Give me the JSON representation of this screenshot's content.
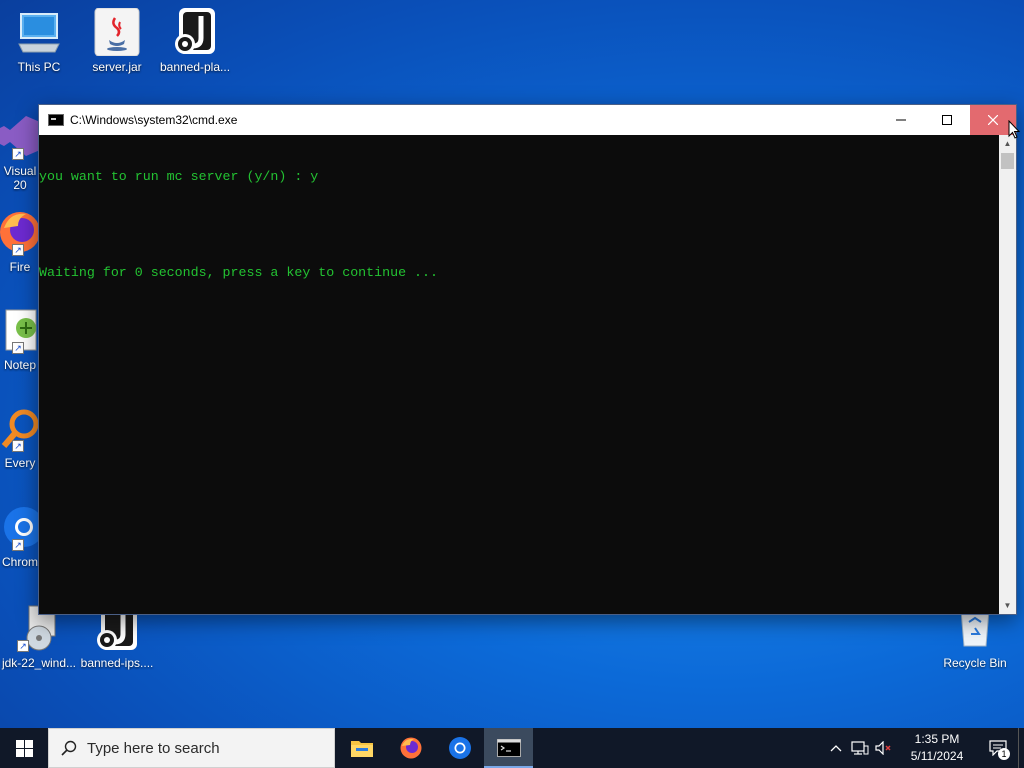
{
  "desktop": {
    "icons_top": [
      {
        "label": "This PC",
        "icon": "monitor-icon"
      },
      {
        "label": "server.jar",
        "icon": "java-icon"
      },
      {
        "label": "banned-pla...",
        "icon": "json-file-icon"
      }
    ],
    "icons_left_partial": [
      {
        "label": "Visual",
        "label2": "20",
        "icon": "visual-studio-icon"
      },
      {
        "label": "Fire",
        "icon": "firefox-icon"
      },
      {
        "label": "Notep",
        "icon": "notepad-icon"
      },
      {
        "label": "Every",
        "icon": "everything-search-icon"
      },
      {
        "label": "Chrom",
        "icon": "chrome-icon"
      }
    ],
    "icons_bottom": [
      {
        "label": "jdk-22_wind...",
        "icon": "installer-icon"
      },
      {
        "label": "banned-ips....",
        "icon": "json-file-icon"
      },
      {
        "label": "Recycle Bin",
        "icon": "recycle-bin-icon"
      }
    ]
  },
  "cmd_window": {
    "title": "C:\\Windows\\system32\\cmd.exe",
    "lines": [
      "you want to run mc server (y/n) : y",
      "",
      "Waiting for 0 seconds, press a key to continue ..."
    ],
    "text_color": "#23c232",
    "background": "#0c0c0c"
  },
  "taskbar": {
    "search_placeholder": "Type here to search",
    "apps": [
      {
        "name": "file-explorer",
        "icon": "folder-icon"
      },
      {
        "name": "firefox",
        "icon": "firefox-icon"
      },
      {
        "name": "chrome",
        "icon": "chrome-icon"
      },
      {
        "name": "command-prompt",
        "icon": "terminal-icon",
        "active": true
      }
    ],
    "clock": {
      "time": "1:35 PM",
      "date": "5/11/2024"
    },
    "notification_count": "1"
  }
}
